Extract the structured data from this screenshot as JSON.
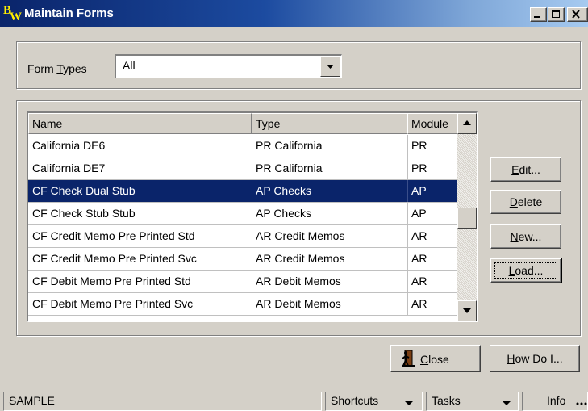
{
  "window": {
    "title": "Maintain Forms",
    "logo": "BW"
  },
  "form_types": {
    "label_pre": "Form ",
    "label_key": "T",
    "label_post": "ypes",
    "value": "All"
  },
  "list": {
    "columns": [
      "Name",
      "Type",
      "Module"
    ],
    "rows": [
      {
        "name": "California DE6",
        "type": "PR California",
        "module": "PR",
        "selected": false
      },
      {
        "name": "California DE7",
        "type": "PR California",
        "module": "PR",
        "selected": false
      },
      {
        "name": "CF Check Dual Stub",
        "type": "AP Checks",
        "module": "AP",
        "selected": true
      },
      {
        "name": "CF Check Stub Stub",
        "type": "AP Checks",
        "module": "AP",
        "selected": false
      },
      {
        "name": "CF Credit Memo Pre Printed Std",
        "type": "AR Credit Memos",
        "module": "AR",
        "selected": false
      },
      {
        "name": "CF Credit Memo Pre Printed Svc",
        "type": "AR Credit Memos",
        "module": "AR",
        "selected": false
      },
      {
        "name": "CF Debit Memo Pre Printed Std",
        "type": "AR Debit Memos",
        "module": "AR",
        "selected": false
      },
      {
        "name": "CF Debit Memo Pre Printed Svc",
        "type": "AR Debit Memos",
        "module": "AR",
        "selected": false
      }
    ]
  },
  "buttons": {
    "edit": {
      "key": "E",
      "rest": "dit..."
    },
    "delete": {
      "key": "D",
      "rest": "elete"
    },
    "new": {
      "key": "N",
      "rest": "ew..."
    },
    "load": {
      "key": "L",
      "rest": "oad..."
    },
    "close": {
      "key": "C",
      "rest": "lose"
    },
    "how_do_i": {
      "key": "H",
      "rest": "ow Do I..."
    }
  },
  "statusbar": {
    "company": "SAMPLE",
    "shortcuts": "Shortcuts",
    "tasks": "Tasks",
    "info": "Info"
  },
  "icons": {
    "close_button_icon": "door-exit-icon",
    "window_controls": [
      "minimize-icon",
      "maximize-icon",
      "close-icon"
    ]
  },
  "colors": {
    "selection": "#0a246a",
    "titlebar_start": "#0a246a",
    "titlebar_end": "#a6caf0",
    "logo_letters": "#ffef00"
  }
}
